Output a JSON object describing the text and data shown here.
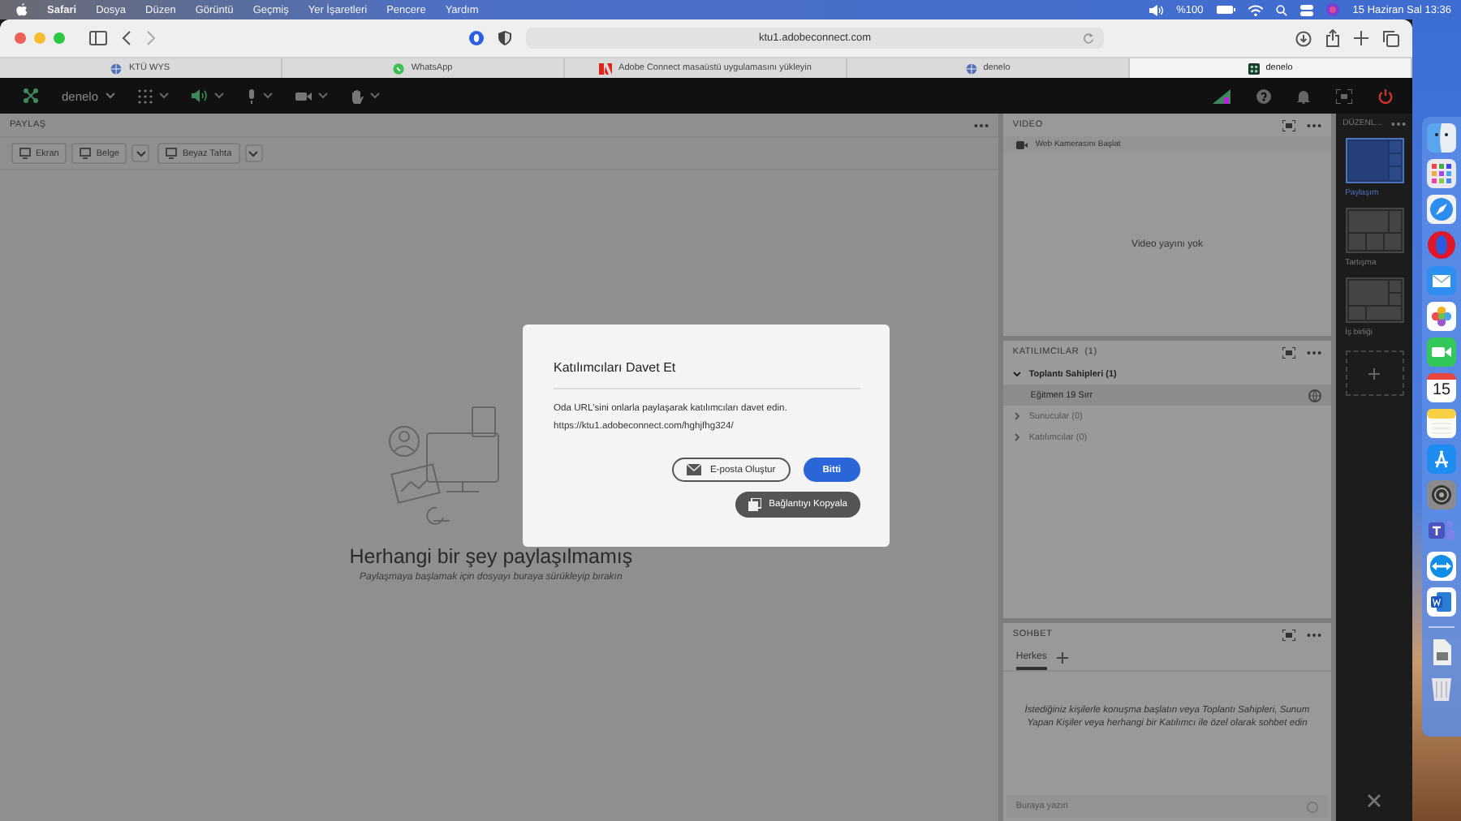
{
  "menu_bar": {
    "items": [
      "Safari",
      "Dosya",
      "Düzen",
      "Görüntü",
      "Geçmiş",
      "Yer İşaretleri",
      "Pencere",
      "Yardım"
    ],
    "battery": "%100",
    "datetime": "15 Haziran Sal  13:36"
  },
  "browser": {
    "address": "ktu1.adobeconnect.com",
    "tabs": [
      {
        "label": "KTÜ WYS",
        "kind": "globe",
        "selected": false
      },
      {
        "label": "WhatsApp",
        "kind": "whatsapp",
        "selected": false
      },
      {
        "label": "Adobe Connect masaüstü uygulamasını yükleyin",
        "kind": "adobe",
        "selected": false
      },
      {
        "label": "denelo",
        "kind": "globe",
        "selected": false
      },
      {
        "label": "denelo",
        "kind": "connect",
        "selected": true
      }
    ]
  },
  "app_bar": {
    "room": "denelo"
  },
  "share_pod": {
    "title": "PAYLAŞ",
    "buttons": [
      {
        "label": "Ekran",
        "menu": false
      },
      {
        "label": "Belge",
        "menu": true
      },
      {
        "label": "Beyaz Tahta",
        "menu": true
      }
    ],
    "empty_title": "Herhangi bir şey paylaşılmamış",
    "empty_hint": "Paylaşmaya başlamak için dosyayı buraya sürükleyip bırakın"
  },
  "video_pod": {
    "title": "VIDEO",
    "start_button": "Web Kamerasını Başlat",
    "empty": "Video yayını yok"
  },
  "attendees_pod": {
    "title": "KATILIMCILAR  (1)",
    "groups": [
      {
        "label": "Toplantı Sahipleri (1)",
        "expanded": true,
        "children": [
          {
            "name": "Eğitmen 19 Sırr"
          }
        ]
      },
      {
        "label": "Sunucular (0)",
        "expanded": false
      },
      {
        "label": "Katılımcılar (0)",
        "expanded": false
      }
    ]
  },
  "chat_pod": {
    "title": "SOHBET",
    "tabs": [
      {
        "label": "Herkes",
        "selected": true
      }
    ],
    "message": "İstediğiniz kişilerle konuşma başlatın veya Toplantı Sahipleri, Sunum Yapan Kişiler veya herhangi bir Katılımcı ile özel olarak sohbet edin",
    "placeholder": "Buraya yazın"
  },
  "layouts": {
    "title": "DÜZENL...",
    "items": [
      {
        "label": "Paylaşım",
        "kind": "share",
        "selected": true
      },
      {
        "label": "Tartışma",
        "kind": "discuss",
        "selected": false
      },
      {
        "label": "İş birliği",
        "kind": "collab",
        "selected": false
      }
    ]
  },
  "dialog": {
    "title": "Katılımcıları Davet Et",
    "text": "Oda URL'sini onlarla paylaşarak katılımcıları davet edin.",
    "url": "https://ktu1.adobeconnect.com/hghjfhg324/",
    "email_button": "E-posta Oluştur",
    "done_button": "Bitti",
    "copy_button": "Bağlantıyı Kopyala"
  },
  "dock": {
    "calendar_day": "15"
  }
}
